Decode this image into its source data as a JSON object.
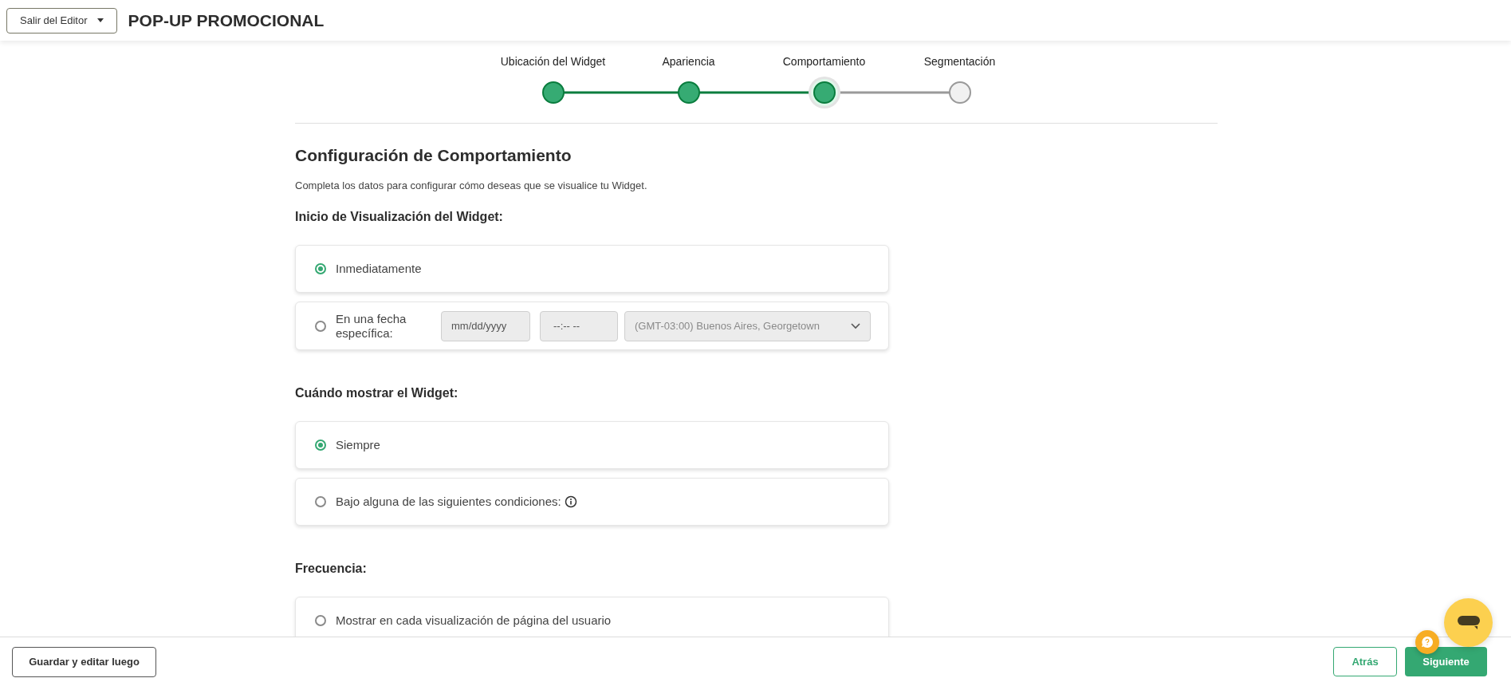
{
  "header": {
    "exit_button": "Salir del Editor",
    "title": "POP-UP PROMOCIONAL"
  },
  "steps": [
    {
      "label": "Ubicación del Widget",
      "completed": true,
      "selected": false
    },
    {
      "label": "Apariencia",
      "completed": true,
      "selected": false
    },
    {
      "label": "Comportamiento",
      "completed": true,
      "selected": true
    },
    {
      "label": "Segmentación",
      "completed": false,
      "selected": false
    }
  ],
  "heading": "Configuración de Comportamiento",
  "subtitle": "Completa los datos para configurar cómo deseas que se visualice tu Widget.",
  "sections": [
    {
      "title": "Inicio de Visualización del Widget:",
      "options": [
        {
          "kind": "plain",
          "label": "Inmediatamente",
          "selected": true
        },
        {
          "kind": "date",
          "label": "En una fecha específica:",
          "selected": false,
          "disabled": true,
          "date_placeholder": "mm/dd/yyyy",
          "time_placeholder": "--:-- --",
          "timezone": "(GMT-03:00) Buenos Aires, Georgetown"
        }
      ]
    },
    {
      "title": "Cuándo mostrar el Widget:",
      "options": [
        {
          "kind": "plain",
          "label": "Siempre",
          "selected": true
        },
        {
          "kind": "info",
          "label": "Bajo alguna de las siguientes condiciones:",
          "selected": false
        }
      ]
    },
    {
      "title": "Frecuencia:",
      "options": [
        {
          "kind": "plain",
          "label": "Mostrar en cada visualización de página del usuario",
          "selected": false
        }
      ]
    }
  ],
  "footer": {
    "save_later": "Guardar y editar luego",
    "back": "Atrás",
    "next": "Siguiente"
  }
}
